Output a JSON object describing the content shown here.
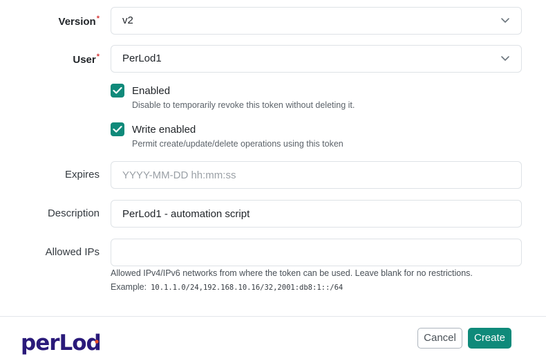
{
  "form": {
    "version": {
      "label": "Version",
      "value": "v2"
    },
    "user": {
      "label": "User",
      "value": "PerLod1"
    },
    "enabled": {
      "label": "Enabled",
      "help": "Disable to temporarily revoke this token without deleting it.",
      "checked": true
    },
    "write_enabled": {
      "label": "Write enabled",
      "help": "Permit create/update/delete operations using this token",
      "checked": true
    },
    "expires": {
      "label": "Expires",
      "value": "",
      "placeholder": "YYYY-MM-DD hh:mm:ss"
    },
    "description": {
      "label": "Description",
      "value": "PerLod1 - automation script"
    },
    "allowed_ips": {
      "label": "Allowed IPs",
      "value": "",
      "help": "Allowed IPv4/IPv6 networks from where the token can be used. Leave blank for no restrictions.",
      "example_label": "Example:",
      "example_value": "10.1.1.0/24,192.168.10.16/32,2001:db8:1::/64"
    },
    "required_mark": "*"
  },
  "footer": {
    "logo_text": "perLod",
    "cancel_label": "Cancel",
    "create_label": "Create"
  },
  "colors": {
    "accent": "#0f8a7a",
    "logo_primary": "#2a1a7a",
    "logo_accent": "#e8502a"
  }
}
